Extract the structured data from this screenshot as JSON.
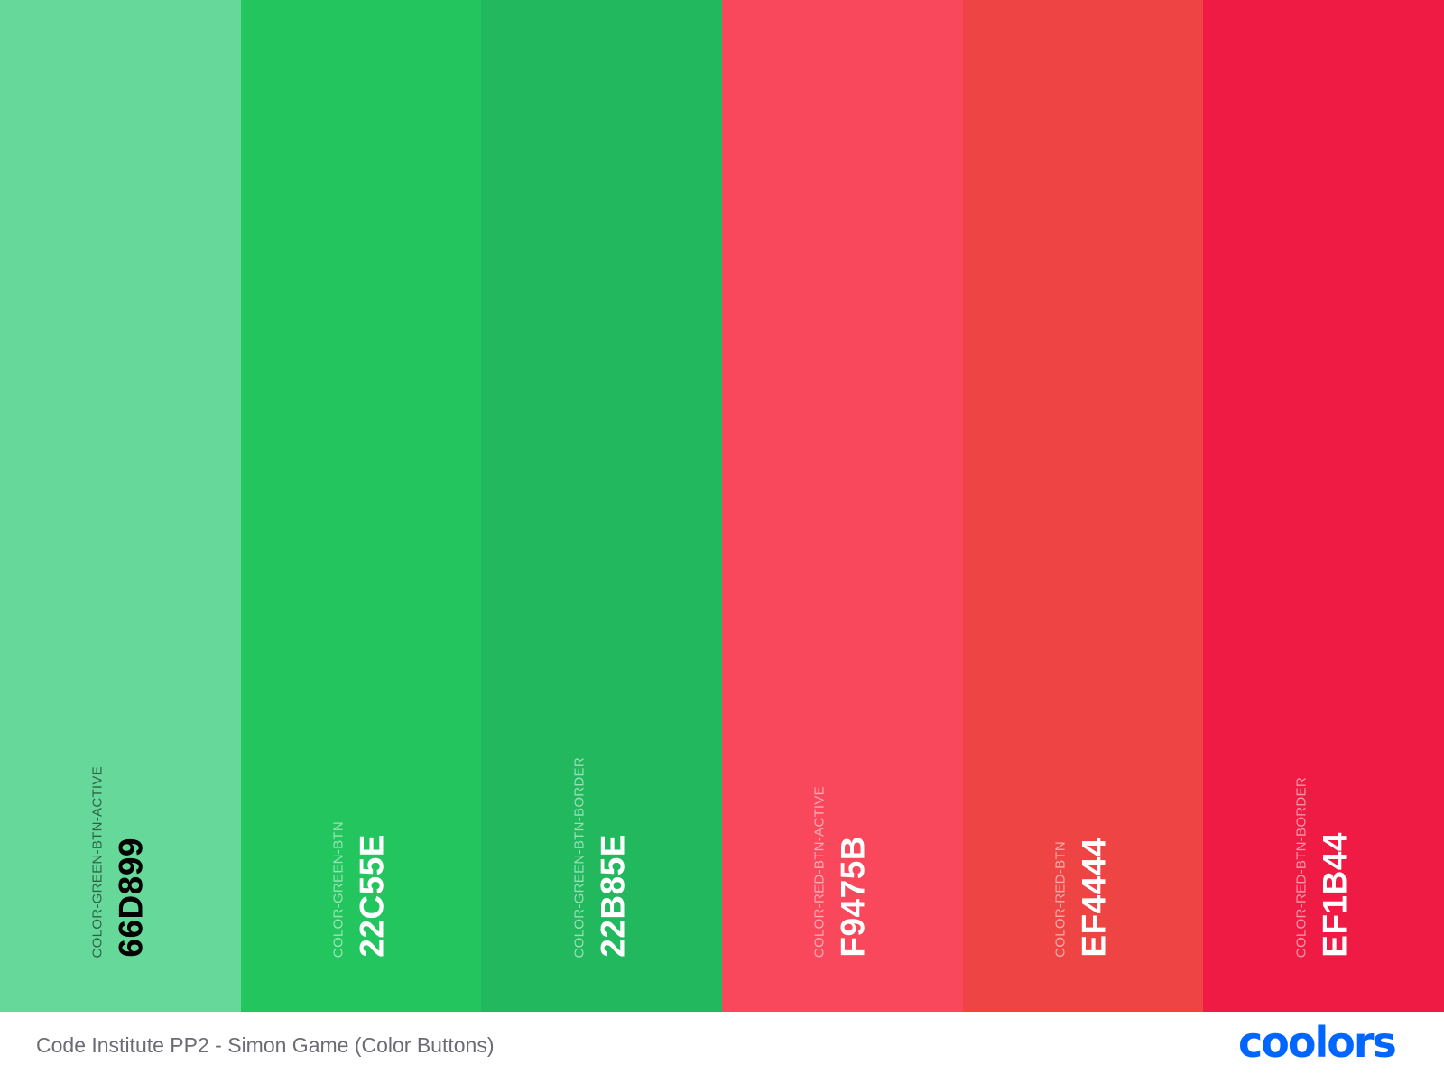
{
  "palette": {
    "swatches": [
      {
        "name": "COLOR-GREEN-BTN-ACTIVE",
        "hex": "66D899",
        "color": "#66D899",
        "text_color": "#000000"
      },
      {
        "name": "COLOR-GREEN-BTN",
        "hex": "22C55E",
        "color": "#22C55E",
        "text_color": "#ffffff"
      },
      {
        "name": "COLOR-GREEN-BTN-BORDER",
        "hex": "22B85E",
        "color": "#22B85E",
        "text_color": "#ffffff"
      },
      {
        "name": "COLOR-RED-BTN-ACTIVE",
        "hex": "F9475B",
        "color": "#F9475B",
        "text_color": "#ffffff"
      },
      {
        "name": "COLOR-RED-BTN",
        "hex": "EF4444",
        "color": "#EF4444",
        "text_color": "#ffffff"
      },
      {
        "name": "COLOR-RED-BTN-BORDER",
        "hex": "EF1B44",
        "color": "#EF1B44",
        "text_color": "#ffffff"
      }
    ]
  },
  "footer": {
    "title": "Code Institute PP2 - Simon Game (Color Buttons)",
    "logo_text": "coolors",
    "logo_color": "#0066FF"
  }
}
